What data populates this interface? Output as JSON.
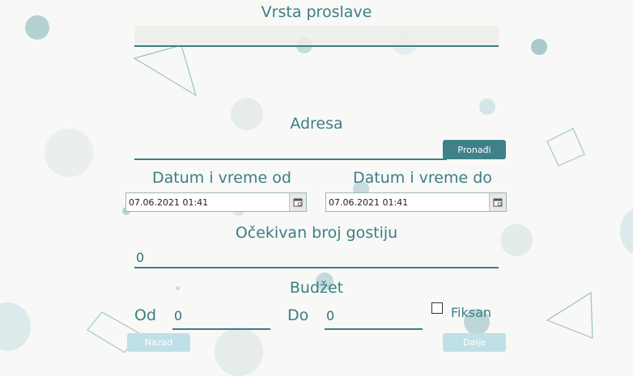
{
  "form": {
    "event_type_label": "Vrsta proslave",
    "event_type_value": "",
    "address_label": "Adresa",
    "address_value": "",
    "find_button": "Pronađi",
    "date_from_label": "Datum i vreme od",
    "date_from_value": "07.06.2021 01:41",
    "date_to_label": "Datum i vreme do",
    "date_to_value": "07.06.2021 01:41",
    "guests_label": "Očekivan broj gostiju",
    "guests_value": "0",
    "budget_label": "Budžet",
    "budget_from_label": "Od",
    "budget_from_value": "0",
    "budget_to_label": "Do",
    "budget_to_value": "0",
    "fixed_label": "Fiksan",
    "fixed_checked": false
  },
  "footer": {
    "back_button": "Nazad",
    "next_button": "Dalje"
  },
  "icons": {
    "calendar": "calendar-icon"
  },
  "colors": {
    "accent": "#3a7f86",
    "button_primary": "#3f8189",
    "button_disabled": "#bfe0e6",
    "background": "#f8f8f6"
  }
}
